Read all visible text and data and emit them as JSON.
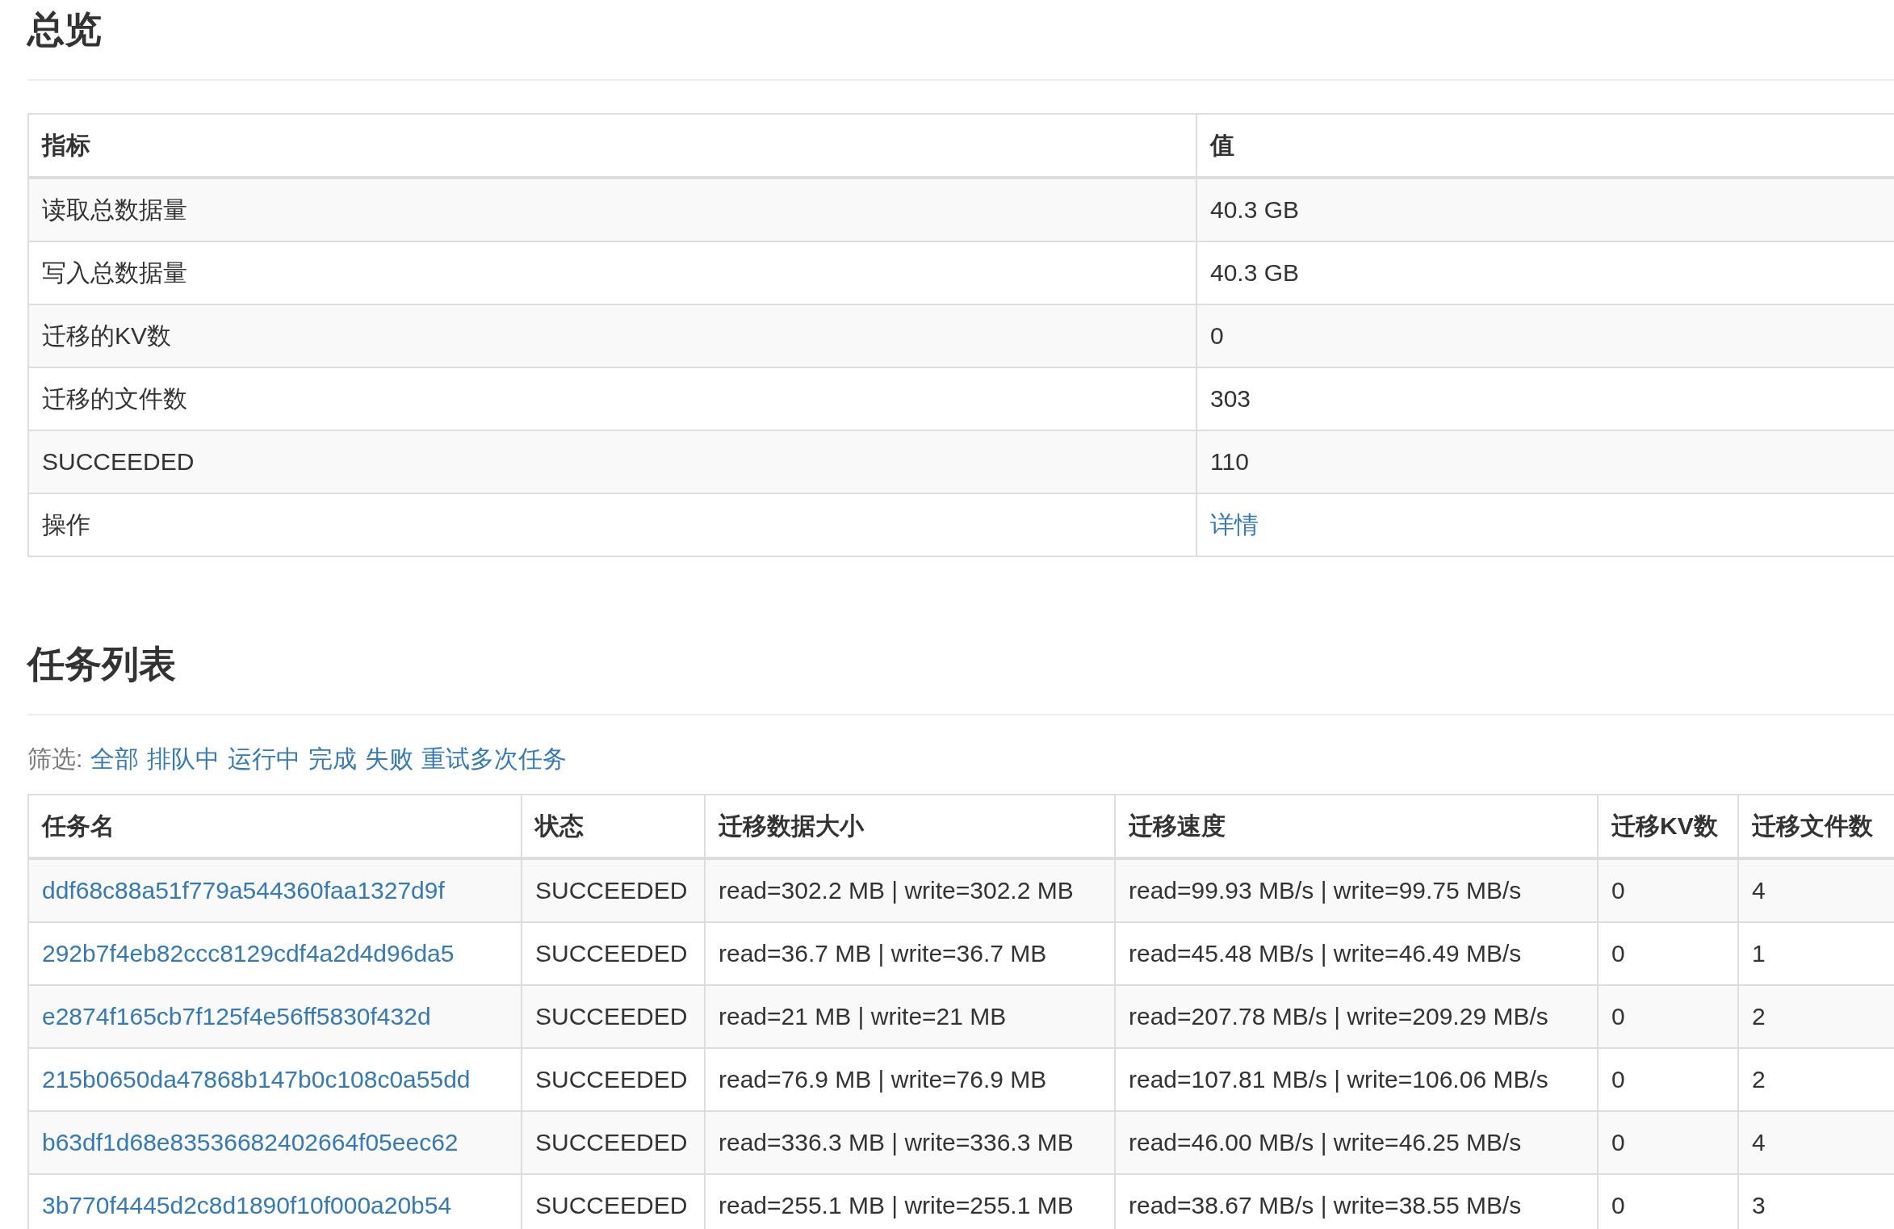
{
  "overview": {
    "title": "总览",
    "columns": [
      "指标",
      "值"
    ],
    "rows": [
      {
        "metric": "读取总数据量",
        "value": "40.3 GB",
        "kind": "text"
      },
      {
        "metric": "写入总数据量",
        "value": "40.3 GB",
        "kind": "text"
      },
      {
        "metric": "迁移的KV数",
        "value": "0",
        "kind": "text"
      },
      {
        "metric": "迁移的文件数",
        "value": "303",
        "kind": "text"
      },
      {
        "metric": "SUCCEEDED",
        "value": "110",
        "kind": "text"
      },
      {
        "metric": "操作",
        "value": "详情",
        "kind": "link"
      }
    ]
  },
  "tasks": {
    "title": "任务列表",
    "filter": {
      "label": "筛选:",
      "options": [
        "全部",
        "排队中",
        "运行中",
        "完成",
        "失败",
        "重试多次任务"
      ]
    },
    "columns": [
      "任务名",
      "状态",
      "迁移数据大小",
      "迁移速度",
      "迁移KV数",
      "迁移文件数"
    ],
    "rows": [
      {
        "name": "ddf68c88a51f779a544360faa1327d9f",
        "status": "SUCCEEDED",
        "size": "read=302.2 MB | write=302.2 MB",
        "speed": "read=99.93 MB/s | write=99.75 MB/s",
        "kv": "0",
        "files": "4"
      },
      {
        "name": "292b7f4eb82ccc8129cdf4a2d4d96da5",
        "status": "SUCCEEDED",
        "size": "read=36.7 MB | write=36.7 MB",
        "speed": "read=45.48 MB/s | write=46.49 MB/s",
        "kv": "0",
        "files": "1"
      },
      {
        "name": "e2874f165cb7f125f4e56ff5830f432d",
        "status": "SUCCEEDED",
        "size": "read=21 MB | write=21 MB",
        "speed": "read=207.78 MB/s | write=209.29 MB/s",
        "kv": "0",
        "files": "2"
      },
      {
        "name": "215b0650da47868b147b0c108c0a55dd",
        "status": "SUCCEEDED",
        "size": "read=76.9 MB | write=76.9 MB",
        "speed": "read=107.81 MB/s | write=106.06 MB/s",
        "kv": "0",
        "files": "2"
      },
      {
        "name": "b63df1d68e83536682402664f05eec62",
        "status": "SUCCEEDED",
        "size": "read=336.3 MB | write=336.3 MB",
        "speed": "read=46.00 MB/s | write=46.25 MB/s",
        "kv": "0",
        "files": "4"
      },
      {
        "name": "3b770f4445d2c8d1890f10f000a20b54",
        "status": "SUCCEEDED",
        "size": "read=255.1 MB | write=255.1 MB",
        "speed": "read=38.67 MB/s | write=38.55 MB/s",
        "kv": "0",
        "files": "3"
      }
    ]
  }
}
